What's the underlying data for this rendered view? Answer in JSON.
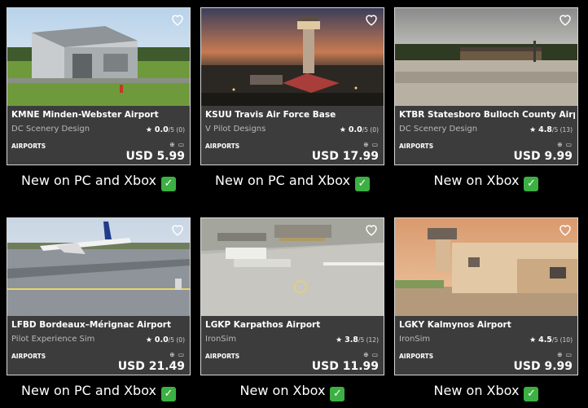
{
  "colors": {
    "check": "#3cb043",
    "card_bg": "#3c3c3c",
    "border": "#d8d8d8"
  },
  "cards": [
    {
      "name": "KMNE Minden-Webster Airport",
      "developer": "DC Scenery Design",
      "rating": "0.0",
      "rating_suffix": "/5 (0)",
      "category": "AIRPORTS",
      "platforms": "⊕ ▭",
      "price": "USD 5.99",
      "caption": "New on PC and Xbox",
      "check": "✓"
    },
    {
      "name": "KSUU Travis Air Force Base",
      "developer": "V Pilot Designs",
      "rating": "0.0",
      "rating_suffix": "/5 (0)",
      "category": "AIRPORTS",
      "platforms": "⊕ ▭",
      "price": "USD 17.99",
      "caption": "New on PC and Xbox",
      "check": "✓"
    },
    {
      "name": "KTBR Statesboro Bulloch County Airport",
      "developer": "DC Scenery Design",
      "rating": "4.8",
      "rating_suffix": "/5 (13)",
      "category": "AIRPORTS",
      "platforms": "⊕ ▭",
      "price": "USD 9.99",
      "caption": "New on Xbox",
      "check": "✓"
    },
    {
      "name": "LFBD Bordeaux–Mérignac Airport",
      "developer": "Pilot Experience Sim",
      "rating": "0.0",
      "rating_suffix": "/5 (0)",
      "category": "AIRPORTS",
      "platforms": "⊕ ▭",
      "price": "USD 21.49",
      "caption": "New on PC and Xbox",
      "check": "✓"
    },
    {
      "name": "LGKP Karpathos Airport",
      "developer": "IronSim",
      "rating": "3.8",
      "rating_suffix": "/5 (12)",
      "category": "AIRPORTS",
      "platforms": "⊕ ▭",
      "price": "USD 11.99",
      "caption": "New on Xbox",
      "check": "✓"
    },
    {
      "name": "LGKY Kalmynos Airport",
      "developer": "IronSim",
      "rating": "4.5",
      "rating_suffix": "/5 (10)",
      "category": "AIRPORTS",
      "platforms": "⊕ ▭",
      "price": "USD 9.99",
      "caption": "New on Xbox",
      "check": "✓"
    }
  ]
}
